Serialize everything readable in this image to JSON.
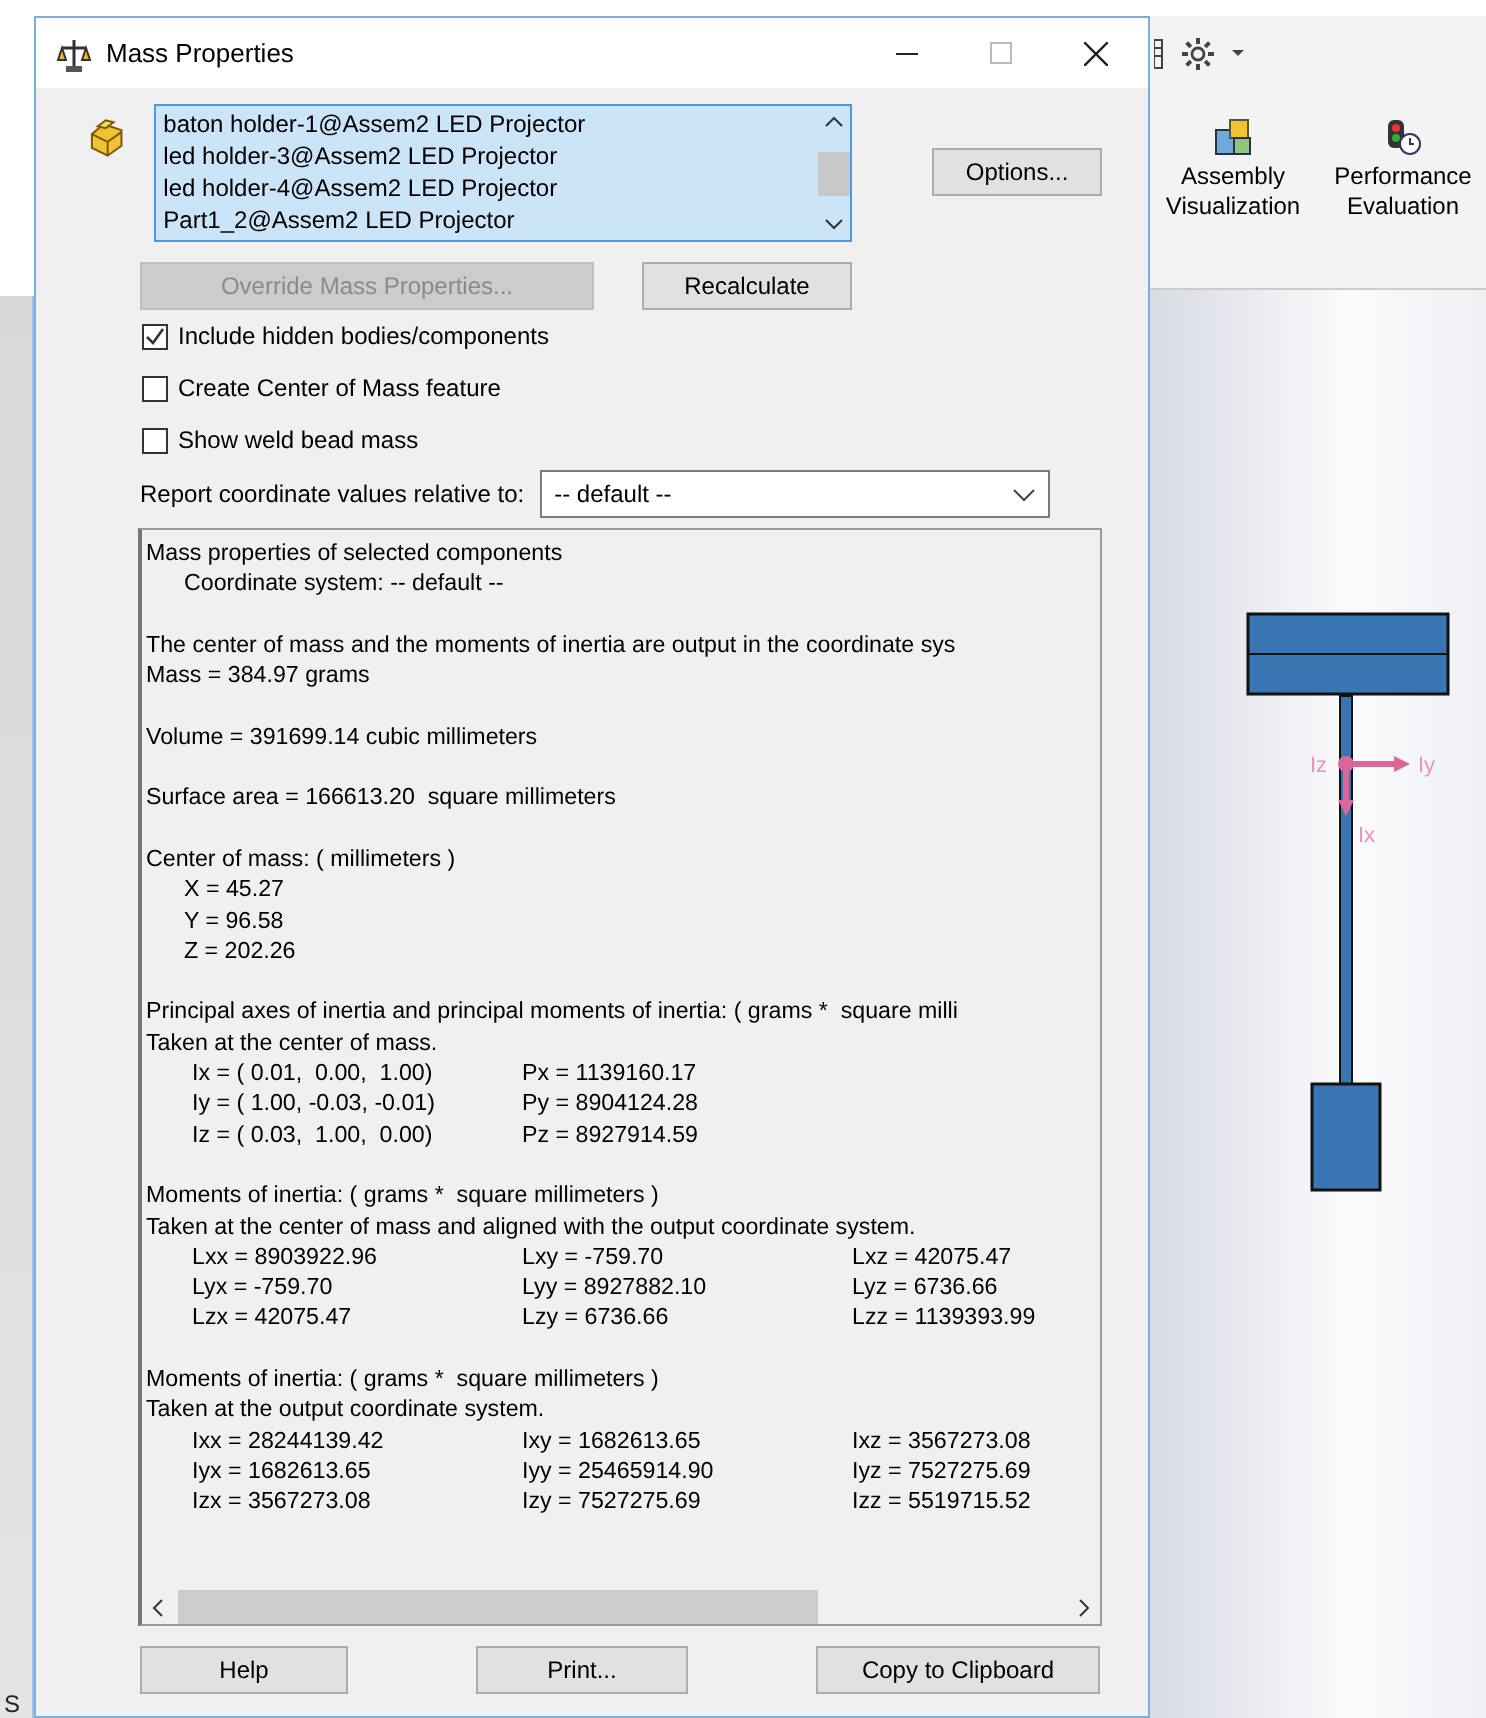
{
  "background_app": {
    "toolbar_items": [
      {
        "label": "Assembly Visualization",
        "kind": "assembly"
      },
      {
        "label": "Performance Evaluation",
        "kind": "performance"
      }
    ],
    "triad_labels": [
      "Iz",
      "Iy",
      "Ix"
    ],
    "status_text": "S"
  },
  "dialog": {
    "title": "Mass Properties",
    "components": [
      "baton holder-1@Assem2 LED Projector",
      "led holder-3@Assem2 LED Projector",
      "led holder-4@Assem2 LED Projector",
      "Part1_2@Assem2 LED Projector"
    ],
    "options_button": "Options...",
    "override_button": {
      "label": "Override Mass Properties...",
      "disabled": true
    },
    "recalculate_button": {
      "label": "Recalculate",
      "disabled": false
    },
    "checkboxes": [
      {
        "label": "Include hidden bodies/components",
        "checked": true
      },
      {
        "label": "Create Center of Mass feature",
        "checked": false
      },
      {
        "label": "Show weld bead mass",
        "checked": false
      }
    ],
    "coordinate_label": "Report coordinate values relative to:",
    "coordinate_value": "-- default --",
    "report": [
      {
        "kind": "line",
        "text": "Mass properties of selected components"
      },
      {
        "kind": "indented",
        "text": "Coordinate system: -- default --"
      },
      {
        "kind": "gap"
      },
      {
        "kind": "line",
        "text": "The center of mass and the moments of inertia are output in the coordinate sys"
      },
      {
        "kind": "line",
        "text": "Mass = 384.97 grams"
      },
      {
        "kind": "gap"
      },
      {
        "kind": "line",
        "text": "Volume = 391699.14 cubic millimeters"
      },
      {
        "kind": "gap"
      },
      {
        "kind": "line",
        "text": "Surface area = 166613.20  square millimeters"
      },
      {
        "kind": "gap"
      },
      {
        "kind": "line",
        "text": "Center of mass: ( millimeters )"
      },
      {
        "kind": "indented",
        "text": "X = 45.27"
      },
      {
        "kind": "indented",
        "text": "Y = 96.58"
      },
      {
        "kind": "indented",
        "text": "Z = 202.26"
      },
      {
        "kind": "gap"
      },
      {
        "kind": "line",
        "text": "Principal axes of inertia and principal moments of inertia: ( grams *  square milli"
      },
      {
        "kind": "line",
        "text": "Taken at the center of mass."
      },
      {
        "kind": "columns",
        "cells": [
          "Ix = ( 0.01,  0.00,  1.00)",
          "Px = 1139160.17"
        ]
      },
      {
        "kind": "columns",
        "cells": [
          "Iy = ( 1.00, -0.03, -0.01)",
          "Py = 8904124.28"
        ]
      },
      {
        "kind": "columns",
        "cells": [
          "Iz = ( 0.03,  1.00,  0.00)",
          "Pz = 8927914.59"
        ]
      },
      {
        "kind": "gap"
      },
      {
        "kind": "line",
        "text": "Moments of inertia: ( grams *  square millimeters )"
      },
      {
        "kind": "line",
        "text": "Taken at the center of mass and aligned with the output coordinate system."
      },
      {
        "kind": "columns",
        "cells": [
          "Lxx = 8903922.96",
          "Lxy = -759.70",
          "Lxz = 42075.47"
        ]
      },
      {
        "kind": "columns",
        "cells": [
          "Lyx = -759.70",
          "Lyy = 8927882.10",
          "Lyz = 6736.66"
        ]
      },
      {
        "kind": "columns",
        "cells": [
          "Lzx = 42075.47",
          "Lzy = 6736.66",
          "Lzz = 1139393.99"
        ]
      },
      {
        "kind": "gap"
      },
      {
        "kind": "line",
        "text": "Moments of inertia: ( grams *  square millimeters )"
      },
      {
        "kind": "line",
        "text": "Taken at the output coordinate system."
      },
      {
        "kind": "columns",
        "cells": [
          "Ixx = 28244139.42",
          "Ixy = 1682613.65",
          "Ixz = 3567273.08"
        ]
      },
      {
        "kind": "columns",
        "cells": [
          "Iyx = 1682613.65",
          "Iyy = 25465914.90",
          "Iyz = 7527275.69"
        ]
      },
      {
        "kind": "columns",
        "cells": [
          "Izx = 3567273.08",
          "Izy = 7527275.69",
          "Izz = 5519715.52"
        ]
      }
    ],
    "footer_buttons": [
      "Help",
      "Print...",
      "Copy to Clipboard"
    ]
  }
}
